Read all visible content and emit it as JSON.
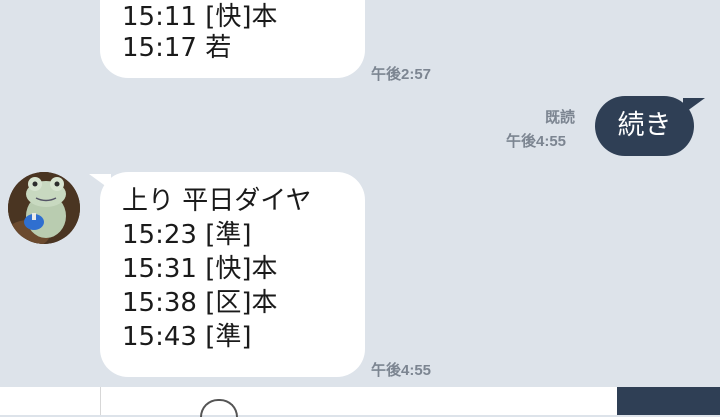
{
  "messages": [
    {
      "side": "left",
      "lines": [
        "15:11 [快]本",
        "15:17 若"
      ],
      "time": "午後2:57"
    },
    {
      "side": "right",
      "text": "続き",
      "read": "既読",
      "time": "午後4:55"
    },
    {
      "side": "left",
      "lines": [
        "上り 平日ダイヤ",
        "15:23 [準]",
        "15:31 [快]本",
        "15:38 [区]本",
        "15:43 [準]"
      ],
      "time": "午後4:55"
    }
  ],
  "colors": {
    "background": "#dde3ea",
    "incoming_bubble": "#ffffff",
    "outgoing_bubble": "#2f3f55",
    "meta_text": "#7c8591"
  },
  "icons": {
    "avatar": "frog-figurine-avatar"
  }
}
